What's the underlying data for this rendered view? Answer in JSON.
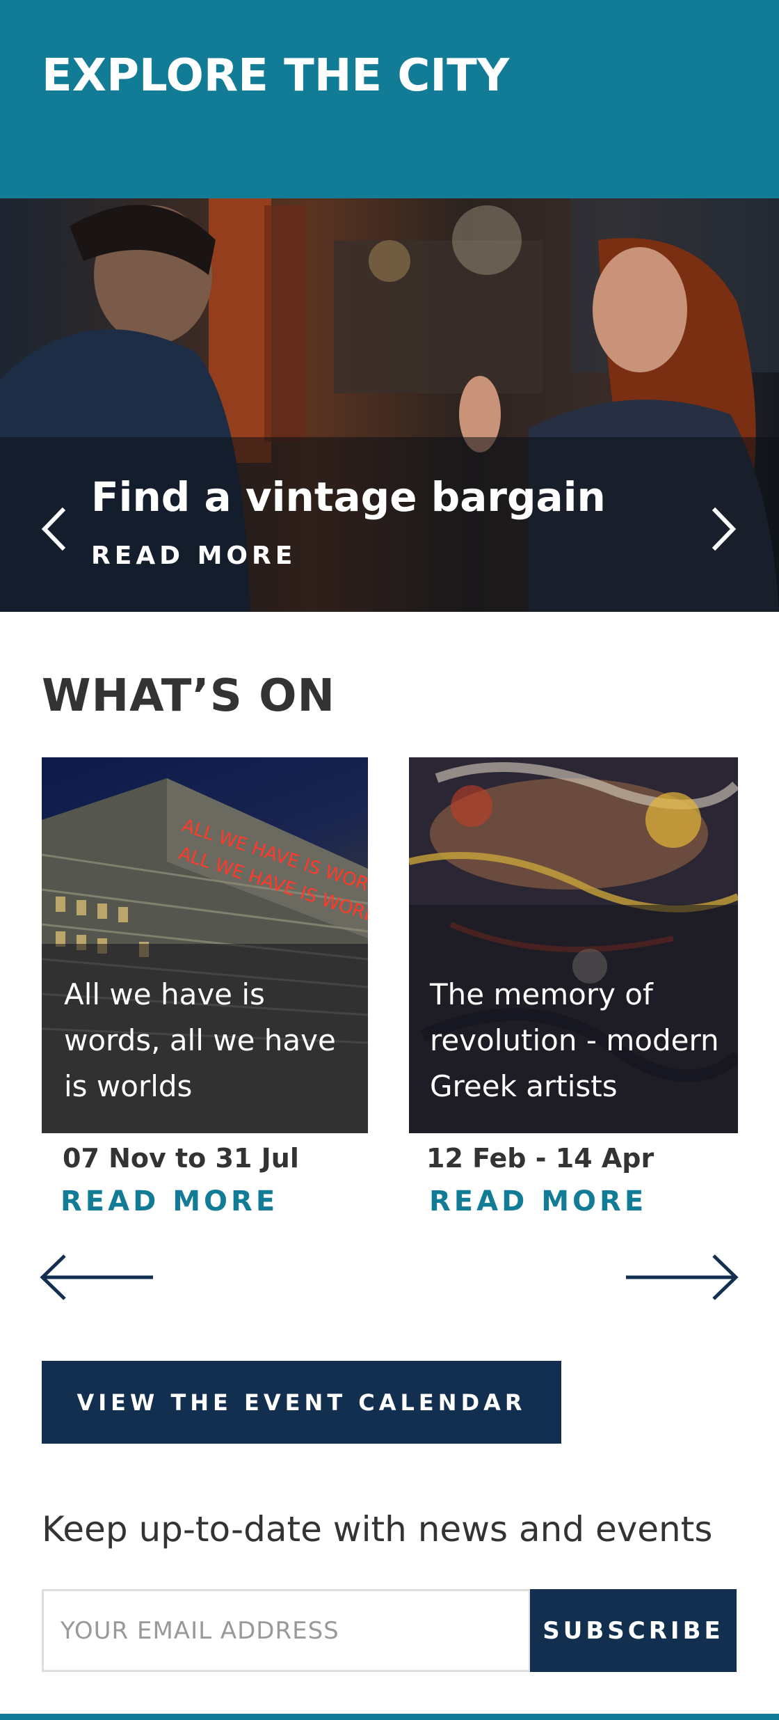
{
  "header": {
    "title": "EXPLORE THE CITY"
  },
  "hero": {
    "title": "Find a vintage bargain",
    "link_label": "READ MORE",
    "prev_icon": "chevron-left-icon",
    "next_icon": "chevron-right-icon"
  },
  "whats_on": {
    "title": "WHAT’S ON",
    "events": [
      {
        "title": "All we have is words, all we have is worlds",
        "date": "07 Nov to 31 Jul",
        "link_label": "READ MORE",
        "image_text": "ALL WE HAVE IS WORDS ALL WE HAVE IS WORLDS"
      },
      {
        "title": "The memory of revolution - modern Greek artists",
        "date": "12 Feb - 14 Apr",
        "link_label": "READ MORE"
      }
    ],
    "prev_icon": "arrow-left-icon",
    "next_icon": "arrow-right-icon"
  },
  "calendar_button": {
    "label": "VIEW THE EVENT CALENDAR"
  },
  "newsletter": {
    "heading": "Keep up-to-date with news and events",
    "email_placeholder": "YOUR EMAIL ADDRESS",
    "subscribe_label": "SUBSCRIBE"
  },
  "colors": {
    "brand_teal": "#127c96",
    "navy": "#132f4f"
  }
}
